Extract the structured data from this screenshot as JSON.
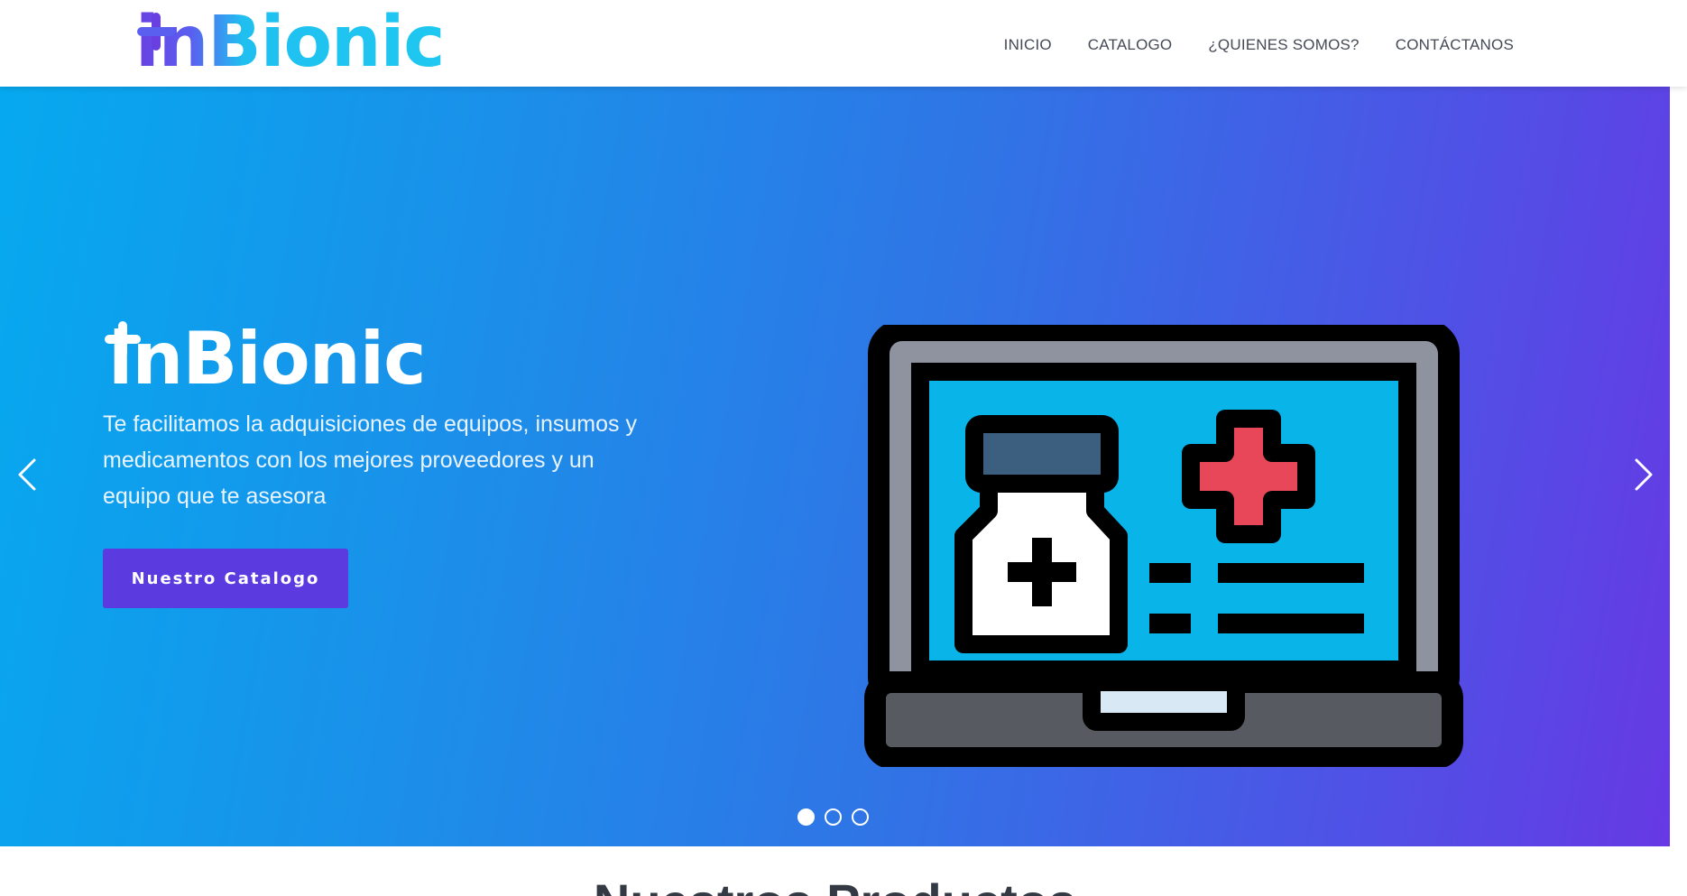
{
  "brand": {
    "logo_text": "inBionic",
    "colors": {
      "purple": "#6a3fe0",
      "cyan": "#1fc8f0",
      "button": "#5b3ae0"
    }
  },
  "nav": {
    "items": [
      {
        "label": "INICIO"
      },
      {
        "label": "CATALOGO"
      },
      {
        "label": "¿QUIENES SOMOS?"
      },
      {
        "label": "CONTÁCTANOS"
      }
    ]
  },
  "hero": {
    "logo_text": "inBionic",
    "description": "Te facilitamos la adquisiciones de equipos, insumos y medicamentos con los mejores proveedores y un equipo que te asesora",
    "cta_label": "Nuestro Catalogo",
    "prev_icon": "chevron-left-icon",
    "next_icon": "chevron-right-icon",
    "illustration": "laptop-medical-icon",
    "slides": {
      "count": 3,
      "active": 1
    }
  },
  "section": {
    "title": "Nuestros Productos"
  }
}
